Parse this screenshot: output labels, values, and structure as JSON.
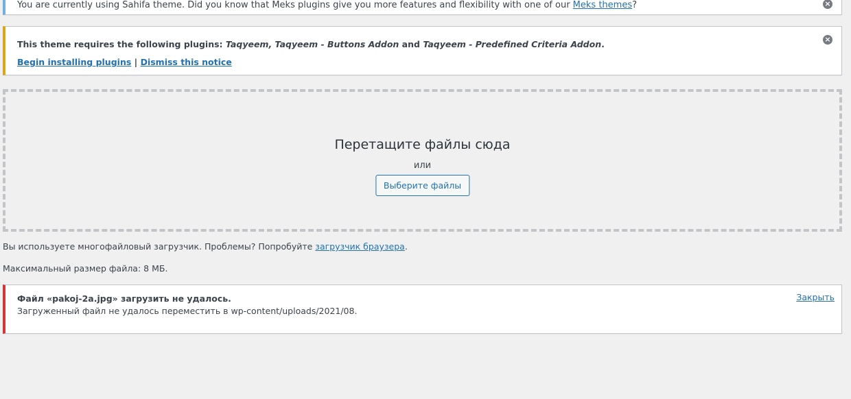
{
  "notice_info": {
    "text_before": "You are currently using Sahifa theme. Did you know that Meks plugins give you more features and flexibility with one of our ",
    "link": "Meks themes",
    "text_after": "?"
  },
  "notice_warning": {
    "intro": "This theme requires the following plugins: ",
    "plugin_1": "Taqyeem, Taqyeem - Buttons Addon",
    "and": " and ",
    "plugin_2": "Taqyeem - Predefined Criteria Addon",
    "end": ".",
    "install_link": "Begin installing plugins",
    "separator": " | ",
    "dismiss_link": "Dismiss this notice"
  },
  "dropzone": {
    "title": "Перетащите файлы сюда",
    "or": "или",
    "button": "Выберите файлы"
  },
  "uploader_info": {
    "text": "Вы используете многофайловый загрузчик. Проблемы? Попробуйте ",
    "link": "загрузчик браузера",
    "end": "."
  },
  "max_size": "Максимальный размер файла: 8 МБ.",
  "error_notice": {
    "title": "Файл «pakoj-2a.jpg» загрузить не удалось.",
    "description": "Загруженный файл не удалось переместить в wp-content/uploads/2021/08.",
    "close": "Закрыть"
  },
  "icons": {
    "dismiss": "dismiss-icon"
  },
  "colors": {
    "info_border": "#72aee6",
    "warning_border": "#dba617",
    "error_border": "#d63638",
    "link": "#2271b1"
  }
}
